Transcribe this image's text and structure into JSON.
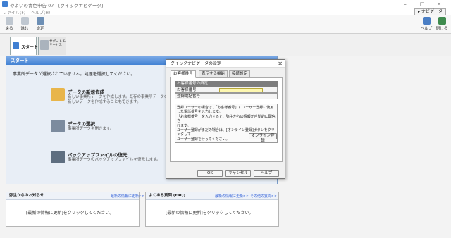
{
  "window": {
    "title": "やよいの青色申告 07 - [クイックナビゲータ]",
    "controls": [
      "–",
      "□",
      "✕"
    ]
  },
  "menu": {
    "items": [
      "ファイル(F)",
      "ヘルプ(H)"
    ]
  },
  "nav_button": {
    "label": "▸ ナビゲータ"
  },
  "toolbar": {
    "left": [
      "戻る",
      "進む",
      "設定"
    ],
    "right": [
      "ヘルプ",
      "閉じる"
    ]
  },
  "tabs": [
    {
      "label": "スタート"
    },
    {
      "label": "サポート & サービス"
    }
  ],
  "start_panel": {
    "header": "スタート",
    "message": "事業所データが選択されていません。処理を選択してください。",
    "items": [
      {
        "title": "データの新規作成",
        "desc1": "新しい事業所データを作成します。既存の事業所データの設定",
        "desc2": "新しいデータを作成することもできます。"
      },
      {
        "title": "データの選択",
        "desc1": "事業所データを開きます。",
        "desc2": ""
      },
      {
        "title": "バックアップファイルの復元",
        "desc1": "事業所データのバックアップファイルを復元します。",
        "desc2": ""
      }
    ]
  },
  "news_panel": {
    "title": "弥生からのお知らせ",
    "link": "最新の情報に更新>>",
    "body": "[最新の情報に更新]をクリックしてください。"
  },
  "faq_panel": {
    "title": "よくある質問 (FAQ)",
    "link1": "最新の情報に更新>>",
    "link2": "その他の質問>>",
    "body": "[最新の情報に更新]をクリックしてください。"
  },
  "dialog": {
    "title": "クイックナビゲータの設定",
    "close": "✕",
    "tabs": [
      "お客様番号",
      "表示する機能",
      "接続設定"
    ],
    "section": "お客様番号の設定",
    "fields": [
      {
        "label": "お客様番号",
        "value": ""
      },
      {
        "label": "登録電話番号",
        "value": ""
      }
    ],
    "note_lines": [
      "登録ユーザーの場合は、「お客様番号」にユーザー登録に使用",
      "した電話番号を入力します。",
      "「お客様番号」を入力すると、弥生からの情報が自動的に配信さ",
      "れます。",
      "ユーザー登録がまだの場合は、[オンライン登録]ボタンをクリックして",
      "ユーザー登録を行ってください。"
    ],
    "online_button": "オンライン登録",
    "ok": "OK",
    "cancel": "キャンセル",
    "help": "ヘルプ"
  }
}
